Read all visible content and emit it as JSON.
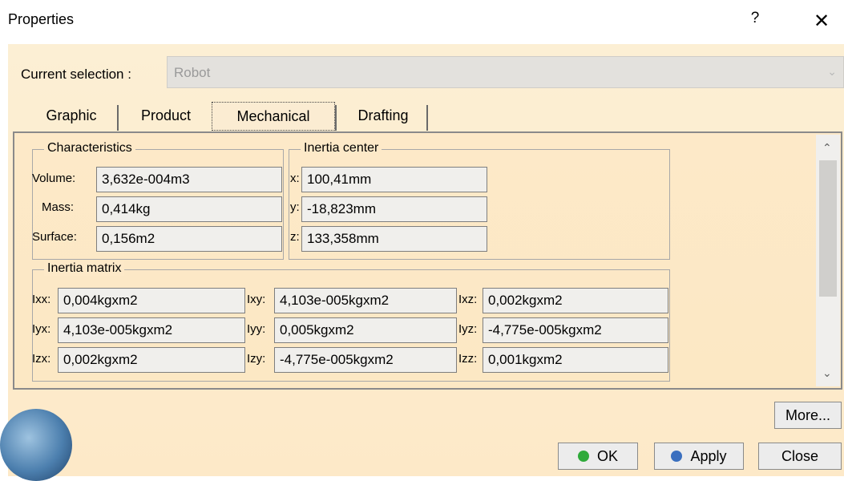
{
  "window": {
    "title": "Properties",
    "help_label": "?",
    "close_label": "✕"
  },
  "selection": {
    "label": "Current selection :",
    "value": "Robot"
  },
  "tabs": [
    {
      "label": "Graphic",
      "active": false
    },
    {
      "label": "Product",
      "active": false
    },
    {
      "label": "Mechanical",
      "active": true
    },
    {
      "label": "Drafting",
      "active": false
    }
  ],
  "characteristics": {
    "title": "Characteristics",
    "volume_label": "Volume:",
    "volume": "3,632e-004m3",
    "mass_label": "Mass:",
    "mass": "0,414kg",
    "surface_label": "Surface:",
    "surface": "0,156m2"
  },
  "inertia_center": {
    "title": "Inertia center",
    "x_label": "x:",
    "x": "100,41mm",
    "y_label": "y:",
    "y": "-18,823mm",
    "z_label": "z:",
    "z": "133,358mm"
  },
  "inertia_matrix": {
    "title": "Inertia matrix",
    "ixx_label": "Ixx:",
    "ixx": "0,004kgxm2",
    "ixy_label": "Ixy:",
    "ixy": "4,103e-005kgxm2",
    "ixz_label": "Ixz:",
    "ixz": "0,002kgxm2",
    "iyx_label": "Iyx:",
    "iyx": "4,103e-005kgxm2",
    "iyy_label": "Iyy:",
    "iyy": "0,005kgxm2",
    "iyz_label": "Iyz:",
    "iyz": "-4,775e-005kgxm2",
    "izx_label": "Izx:",
    "izx": "0,002kgxm2",
    "izy_label": "Izy:",
    "izy": "-4,775e-005kgxm2",
    "izz_label": "Izz:",
    "izz": "0,001kgxm2"
  },
  "buttons": {
    "more": "More...",
    "ok": "OK",
    "apply": "Apply",
    "close": "Close"
  },
  "colors": {
    "ok_dot": "#2faa3a",
    "apply_dot": "#3a6fbf"
  }
}
